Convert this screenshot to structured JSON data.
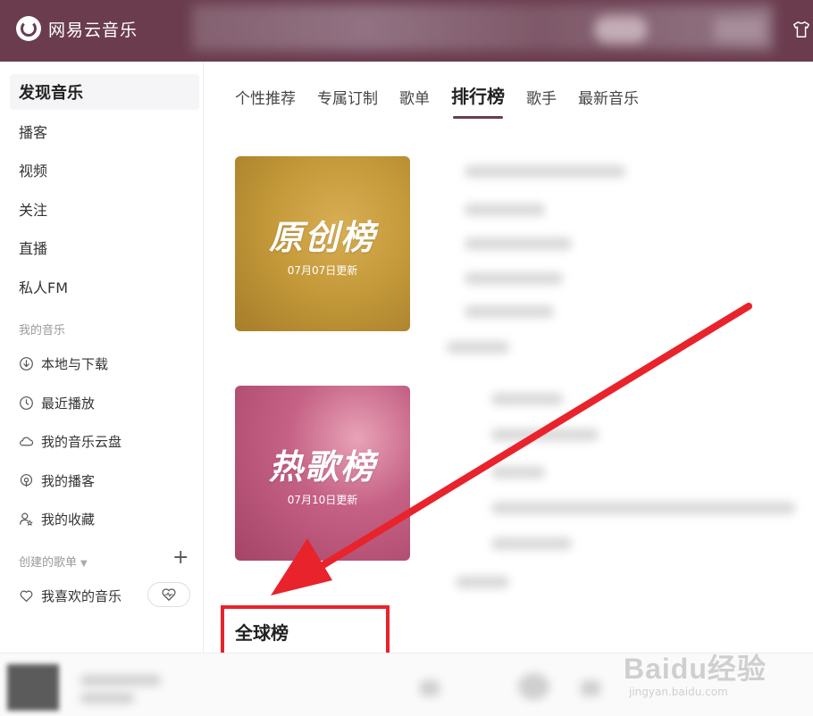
{
  "app": {
    "name": "网易云音乐"
  },
  "sidebar": {
    "main_items": [
      {
        "label": "发现音乐"
      },
      {
        "label": "播客"
      },
      {
        "label": "视频"
      },
      {
        "label": "关注"
      },
      {
        "label": "直播"
      },
      {
        "label": "私人FM"
      }
    ],
    "my_music_title": "我的音乐",
    "my_music_items": [
      {
        "label": "本地与下载",
        "icon": "download-icon"
      },
      {
        "label": "最近播放",
        "icon": "clock-icon"
      },
      {
        "label": "我的音乐云盘",
        "icon": "cloud-icon"
      },
      {
        "label": "我的播客",
        "icon": "podcast-icon"
      },
      {
        "label": "我的收藏",
        "icon": "user-star-icon"
      }
    ],
    "created_playlists_title": "创建的歌单",
    "liked_music": "我喜欢的音乐"
  },
  "tabs": [
    {
      "label": "个性推荐"
    },
    {
      "label": "专属订制"
    },
    {
      "label": "歌单"
    },
    {
      "label": "排行榜"
    },
    {
      "label": "歌手"
    },
    {
      "label": "最新音乐"
    }
  ],
  "active_tab": "排行榜",
  "charts": [
    {
      "title": "原创榜",
      "updated": "07月07日更新",
      "color": "#c49a3a"
    },
    {
      "title": "热歌榜",
      "updated": "07月10日更新",
      "color": "#c56185"
    }
  ],
  "global_section": {
    "title": "全球榜"
  },
  "annotation_color": "#e8232c",
  "brand_color": "#6a3c4e",
  "watermark": {
    "main": "Baidu经验",
    "sub": "jingyan.baidu.com"
  }
}
